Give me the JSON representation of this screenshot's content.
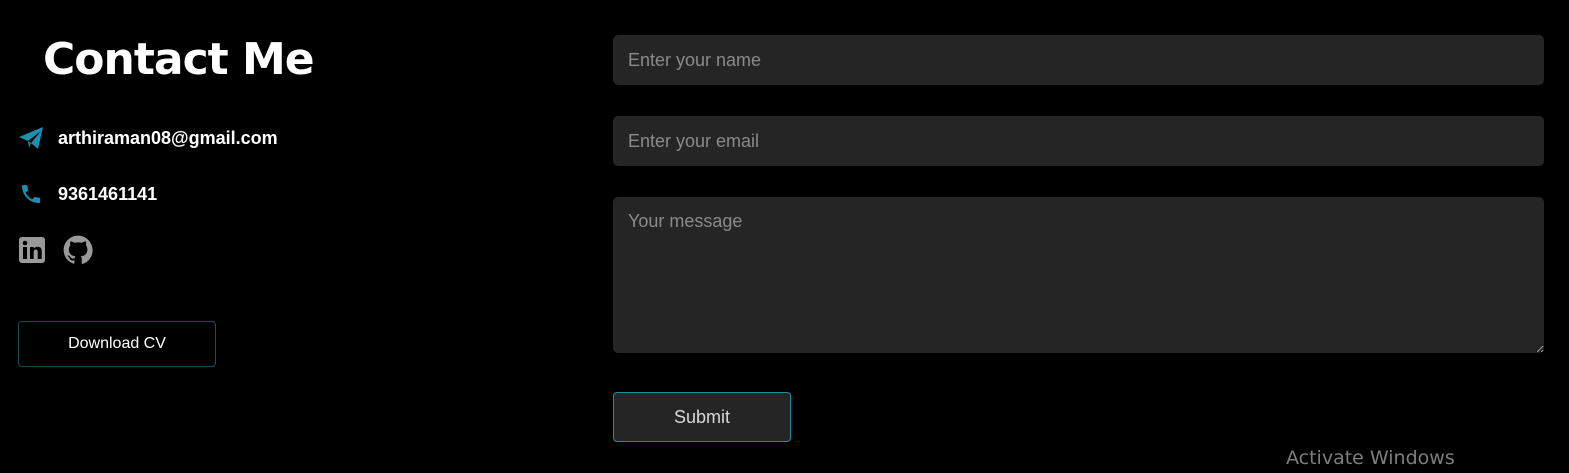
{
  "heading": "Contact Me",
  "contact": {
    "email": "arthiraman08@gmail.com",
    "phone": "9361461141",
    "icon_color": "#1b8fb0"
  },
  "socials": [
    {
      "icon": "linkedin-icon"
    },
    {
      "icon": "github-icon"
    }
  ],
  "buttons": {
    "download_cv": "Download CV",
    "submit": "Submit"
  },
  "form": {
    "name_placeholder": "Enter your name",
    "email_placeholder": "Enter your email",
    "message_placeholder": "Your message",
    "name_value": "",
    "email_value": "",
    "message_value": ""
  },
  "watermark": "Activate Windows",
  "colors": {
    "background": "#000000",
    "field_background": "#252525",
    "accent": "#1e8fa3"
  }
}
